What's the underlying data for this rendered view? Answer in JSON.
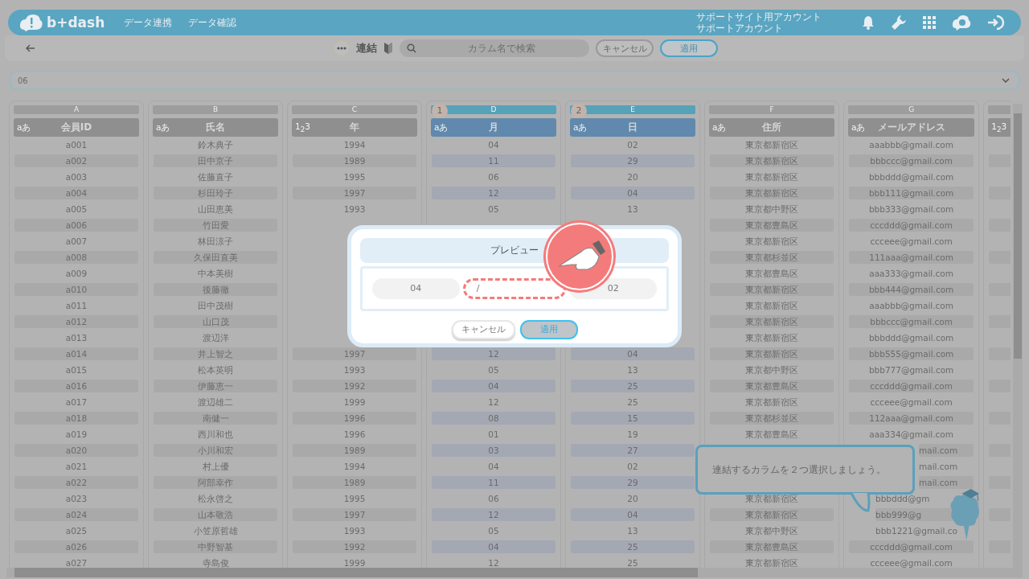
{
  "header": {
    "logo": "b+dash",
    "nav": [
      "データ連携",
      "データ確認"
    ],
    "account": [
      "サポートサイト用アカウント",
      "サポートアカウント"
    ]
  },
  "toolbar": {
    "title": "連結",
    "search": {
      "placeholder": "カラム名で検索"
    },
    "buttons": [
      {
        "label": "キャンセル",
        "kind": "secondary"
      },
      {
        "label": "適用",
        "kind": "primary"
      }
    ]
  },
  "dropdown": {
    "value": "06"
  },
  "columns": [
    {
      "letter": "A",
      "name": "会員ID",
      "type_label": "aあ",
      "selected": false
    },
    {
      "letter": "B",
      "name": "氏名",
      "type_label": "aあ",
      "selected": false
    },
    {
      "letter": "C",
      "name": "年",
      "type_label": "1$_{2}$3",
      "selected": false
    },
    {
      "letter": "D",
      "name": "月",
      "type_label": "aあ",
      "selected": true,
      "badge": "1"
    },
    {
      "letter": "E",
      "name": "日",
      "type_label": "aあ",
      "selected": true,
      "badge": "2"
    },
    {
      "letter": "F",
      "name": "住所",
      "type_label": "aあ",
      "selected": false
    },
    {
      "letter": "G",
      "name": "メールアドレス",
      "type_label": "aあ",
      "selected": false
    },
    {
      "type_label": "1$_{2}$3",
      "selected": false
    }
  ],
  "rows": [
    {
      "cells": {
        "A": "a001",
        "B": "鈴木典子",
        "C": "1994",
        "D": "04",
        "E": "02",
        "F": "東京都新宿区",
        "G": "aaabbb@gmail.com"
      }
    },
    {
      "cells": {
        "A": "a002",
        "B": "田中京子",
        "C": "1989",
        "D": "11",
        "E": "29",
        "F": "東京都新宿区",
        "G": "bbbccc@gmail.com"
      }
    },
    {
      "cells": {
        "A": "a003",
        "B": "佐藤直子",
        "C": "1995",
        "D": "06",
        "E": "20",
        "F": "東京都新宿区",
        "G": "bbbddd@gmail.com"
      }
    },
    {
      "cells": {
        "A": "a004",
        "B": "杉田玲子",
        "C": "1997",
        "D": "12",
        "E": "04",
        "F": "東京都新宿区",
        "G": "bbb111@gmail.com"
      }
    },
    {
      "cells": {
        "A": "a005",
        "B": "山田恵美",
        "C": "1993",
        "D": "05",
        "E": "13",
        "F": "東京都中野区",
        "G": "bbb333@gmail.com"
      }
    },
    {
      "cells": {
        "A": "a006",
        "B": "竹田愛",
        "F": "東京都豊島区",
        "G": "cccddd@gmail.com"
      }
    },
    {
      "cells": {
        "A": "a007",
        "B": "林田涼子",
        "F": "東京都新宿区",
        "G": "ccceee@gmail.com"
      }
    },
    {
      "cells": {
        "A": "a008",
        "B": "久保田直美",
        "F": "東京都杉並区",
        "G": "111aaa@gmail.com"
      }
    },
    {
      "cells": {
        "A": "a009",
        "B": "中本美樹",
        "F": "東京都豊島区",
        "G": "aaa333@gmail.com"
      }
    },
    {
      "cells": {
        "A": "a010",
        "B": "後藤徹",
        "F": "東京都新宿区",
        "G": "bbb444@gmail.com"
      }
    },
    {
      "cells": {
        "A": "a011",
        "B": "田中茂樹",
        "F": "東京都新宿区",
        "G": "aaabbb@gmail.com"
      }
    },
    {
      "cells": {
        "A": "a012",
        "B": "山口茂",
        "F": "東京都新宿区",
        "G": "bbbccc@gmail.com"
      }
    },
    {
      "cells": {
        "A": "a013",
        "B": "渡辺洋",
        "F": "東京都新宿区",
        "G": "bbbddd@gmail.com"
      }
    },
    {
      "cells": {
        "A": "a014",
        "B": "井上智之",
        "C": "1997",
        "D": "12",
        "E": "04",
        "F": "東京都新宿区",
        "G": "bbb555@gmail.com"
      }
    },
    {
      "cells": {
        "A": "a015",
        "B": "松本英明",
        "C": "1993",
        "D": "05",
        "E": "13",
        "F": "東京都中野区",
        "G": "bbb777@gmail.com"
      }
    },
    {
      "cells": {
        "A": "a016",
        "B": "伊藤恵一",
        "C": "1992",
        "D": "04",
        "E": "25",
        "F": "東京都豊島区",
        "G": "cccddd@gmail.com"
      }
    },
    {
      "cells": {
        "A": "a017",
        "B": "渡辺雄二",
        "C": "1999",
        "D": "12",
        "E": "25",
        "F": "東京都新宿区",
        "G": "ccceee@gmail.com"
      }
    },
    {
      "cells": {
        "A": "a018",
        "B": "南健一",
        "C": "1996",
        "D": "08",
        "E": "15",
        "F": "東京都杉並区",
        "G": "112aaa@gmail.com"
      }
    },
    {
      "cells": {
        "A": "a019",
        "B": "西川和也",
        "C": "1996",
        "D": "01",
        "E": "19",
        "F": "東京都豊島区",
        "G": "aaa334@gmail.com"
      }
    },
    {
      "cells": {
        "A": "a020",
        "B": "小川和宏",
        "C": "1989",
        "D": "03",
        "E": "27",
        "G": {
          "text": "mail.com",
          "cut_at_start": true
        }
      }
    },
    {
      "cells": {
        "A": "a021",
        "B": "村上優",
        "C": "1994",
        "D": "04",
        "E": "02",
        "G": {
          "text": "mail.com",
          "cut_at_start": true
        }
      }
    },
    {
      "cells": {
        "A": "a022",
        "B": "阿部幸作",
        "C": "1989",
        "D": "11",
        "E": "29",
        "G": {
          "text": "mail.com",
          "cut_at_start": true
        }
      }
    },
    {
      "cells": {
        "A": "a023",
        "B": "松永啓之",
        "C": "1995",
        "D": "06",
        "E": "20",
        "F": "東京都新宿区",
        "G": {
          "text": "bbbddd@gm",
          "cut_at_end": true
        }
      }
    },
    {
      "cells": {
        "A": "a024",
        "B": "山本敬浩",
        "C": "1997",
        "D": "12",
        "E": "04",
        "F": "東京都新宿区",
        "G": {
          "text": "bbb999@g",
          "cut_at_end": true
        }
      }
    },
    {
      "cells": {
        "A": "a025",
        "B": "小笠原哲雄",
        "C": "1993",
        "D": "05",
        "E": "13",
        "F": "東京都中野区",
        "G": {
          "text": "bbb1221@gmail.co",
          "cut_at_end": true
        }
      }
    },
    {
      "cells": {
        "A": "a026",
        "B": "中野智基",
        "C": "1992",
        "D": "04",
        "E": "25",
        "F": "東京都豊島区",
        "G": "cccddd@gmail.com"
      }
    },
    {
      "cells": {
        "A": "a027",
        "B": "寺島俊",
        "C": "1999",
        "D": "12",
        "E": "25",
        "F": "東京都新宿区",
        "G": "ccceee@gmail.com"
      }
    }
  ],
  "dialog": {
    "title": "プレビュー",
    "pieces": [
      {
        "text": "04",
        "kind": "value"
      },
      {
        "text": "/",
        "kind": "separator"
      },
      {
        "text": "02",
        "kind": "value"
      }
    ],
    "buttons": [
      {
        "label": "キャンセル",
        "kind": "secondary"
      },
      {
        "label": "適用",
        "kind": "primary"
      }
    ]
  },
  "tooltip": {
    "text": "連結するカラムを２つ選択しましょう。"
  }
}
